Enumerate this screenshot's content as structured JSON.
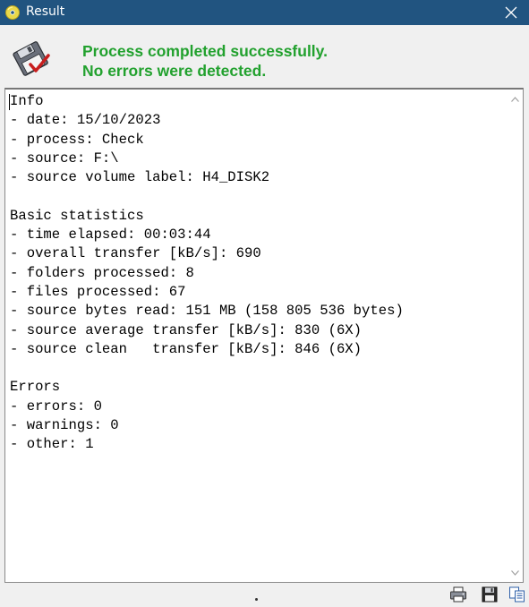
{
  "window": {
    "title": "Result",
    "icons": {
      "app": "cd-disc-icon",
      "close": "close-icon"
    }
  },
  "header": {
    "icon": "floppy-disk-checkmark-icon",
    "line1": "Process completed successfully.",
    "line2": "No errors were detected.",
    "color": "#22a12e"
  },
  "log": {
    "lines": [
      "Info",
      "- date: 15/10/2023",
      "- process: Check",
      "- source: F:\\",
      "- source volume label: H4_DISK2",
      "",
      "Basic statistics",
      "- time elapsed: 00:03:44",
      "- overall transfer [kB/s]: 690",
      "- folders processed: 8",
      "- files processed: 67",
      "- source bytes read: 151 MB (158 805 536 bytes)",
      "- source average transfer [kB/s]: 830 (6X)",
      "- source clean   transfer [kB/s]: 846 (6X)",
      "",
      "Errors",
      "- errors: 0",
      "- warnings: 0",
      "- other: 1"
    ]
  },
  "toolbar": {
    "icons": [
      "printer-icon",
      "save-icon",
      "copy-icon"
    ]
  },
  "colors": {
    "titlebar": "#215480",
    "success_text": "#22a12e"
  }
}
